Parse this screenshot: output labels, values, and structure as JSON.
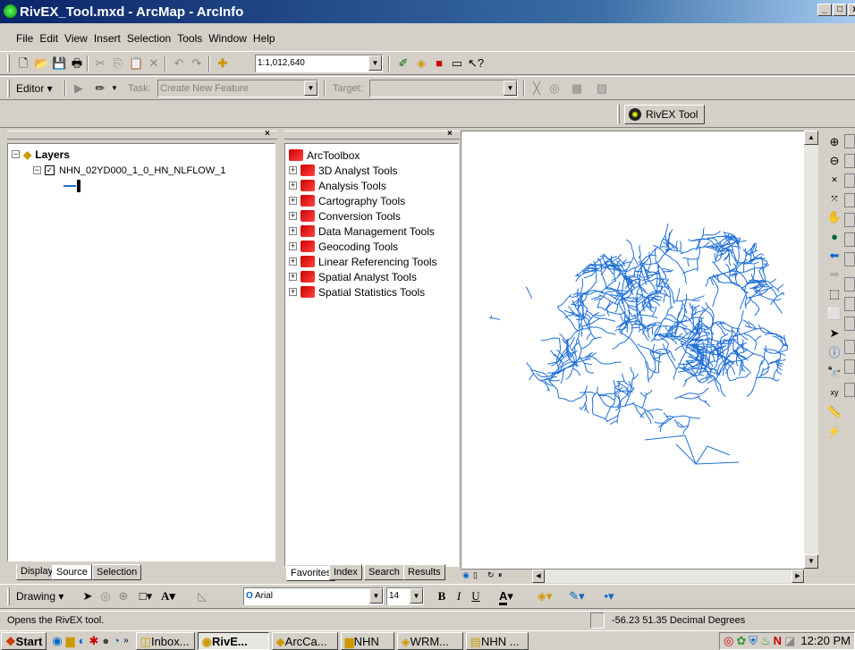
{
  "window": {
    "title": "RivEX_Tool.mxd - ArcMap - ArcInfo",
    "min": "_",
    "max": "□"
  },
  "menu": [
    "File",
    "Edit",
    "View",
    "Insert",
    "Selection",
    "Tools",
    "Window",
    "Help"
  ],
  "standard_toolbar": {
    "scale": "1:1,012,640",
    "icons": [
      "new-icon",
      "open-icon",
      "save-icon",
      "print-icon",
      "cut-icon",
      "copy-icon",
      "paste-icon",
      "delete-icon",
      "undo-icon",
      "redo-icon",
      "add-data-icon",
      "editor-toolbar-icon",
      "arccatalog-icon",
      "arctoolbox-icon",
      "command-line-icon",
      "whats-this-icon"
    ]
  },
  "editor_toolbar": {
    "editor_label": "Editor ▾",
    "task_label": "Task:",
    "task_value": "Create New Feature",
    "target_label": "Target:",
    "target_value": ""
  },
  "rivex": {
    "label": "RivEX Tool"
  },
  "toc": {
    "root": "Layers",
    "layer": "NHN_02YD000_1_0_HN_NLFLOW_1",
    "tabs": [
      "Display",
      "Source",
      "Selection"
    ]
  },
  "toolbox": {
    "root": "ArcToolbox",
    "items": [
      "3D Analyst Tools",
      "Analysis Tools",
      "Cartography Tools",
      "Conversion Tools",
      "Data Management Tools",
      "Geocoding Tools",
      "Linear Referencing Tools",
      "Spatial Analyst Tools",
      "Spatial Statistics Tools"
    ],
    "tabs": [
      "Favorites",
      "Index",
      "Search",
      "Results"
    ]
  },
  "drawing_toolbar": {
    "label": "Drawing ▾",
    "font": "Arial",
    "size": "14",
    "bold": "B",
    "italic": "I",
    "underline": "U",
    "font_color": "A"
  },
  "status": {
    "message": "Opens the RivEX tool.",
    "coords": "-56.23  51.35 Decimal Degrees"
  },
  "taskbar": {
    "start": "Start",
    "tasks": [
      "Inbox...",
      "RivE...",
      "ArcCa...",
      "NHN",
      "WRM...",
      "NHN ..."
    ],
    "active": 1,
    "clock": "12:20 PM"
  },
  "colors": {
    "title_start": "#0a246a",
    "river": "#1f6fd6",
    "face": "#d4d0c8"
  }
}
